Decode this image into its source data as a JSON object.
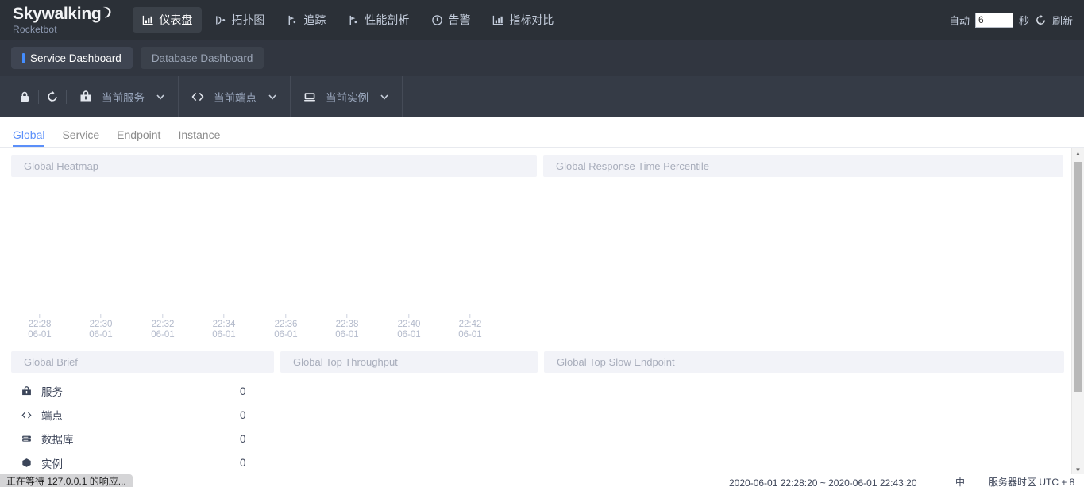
{
  "brand": {
    "name": "Skywalking",
    "sub": "Rocketbot",
    "accent": "#448dfe"
  },
  "topnav": {
    "items": [
      {
        "label": "仪表盘",
        "icon": "dashboard-chart-icon",
        "active": true
      },
      {
        "label": "拓扑图",
        "icon": "topology-icon",
        "active": false
      },
      {
        "label": "追踪",
        "icon": "trace-icon",
        "active": false
      },
      {
        "label": "性能剖析",
        "icon": "profile-icon",
        "active": false
      },
      {
        "label": "告警",
        "icon": "alarm-clock-icon",
        "active": false
      },
      {
        "label": "指标对比",
        "icon": "compare-chart-icon",
        "active": false
      }
    ],
    "auto_label": "自动",
    "interval_value": "6",
    "second_label": "秒",
    "refresh_label": "刷新",
    "refresh_icon": "reload-icon"
  },
  "dashboard_tabs": [
    {
      "label": "Service Dashboard",
      "active": true
    },
    {
      "label": "Database Dashboard",
      "active": false
    }
  ],
  "toolbar": {
    "lock_icon": "lock-icon",
    "reload_icon": "reload-icon",
    "selectors": [
      {
        "label": "当前服务",
        "icon": "service-bag-icon"
      },
      {
        "label": "当前端点",
        "icon": "code-brackets-icon"
      },
      {
        "label": "当前实例",
        "icon": "instance-monitor-icon"
      }
    ]
  },
  "subtabs": [
    {
      "label": "Global",
      "active": true
    },
    {
      "label": "Service",
      "active": false
    },
    {
      "label": "Endpoint",
      "active": false
    },
    {
      "label": "Instance",
      "active": false
    }
  ],
  "panels": {
    "heatmap": {
      "title": "Global Heatmap"
    },
    "percentile": {
      "title": "Global Response Time Percentile"
    },
    "brief": {
      "title": "Global Brief"
    },
    "top_throughput": {
      "title": "Global Top Throughput"
    },
    "top_slow_endpoint": {
      "title": "Global Top Slow Endpoint"
    }
  },
  "brief_rows": [
    {
      "icon": "service-bag-icon",
      "name": "服务",
      "value": "0"
    },
    {
      "icon": "code-brackets-icon",
      "name": "端点",
      "value": "0"
    },
    {
      "icon": "database-icon",
      "name": "数据库",
      "value": "0"
    },
    {
      "icon": "cube-icon",
      "name": "实例",
      "value": "0"
    }
  ],
  "chart_data": {
    "type": "heatmap",
    "title": "Global Heatmap",
    "xlabel": "",
    "ylabel": "",
    "grid": false,
    "legend": "none",
    "x_tick_labels": [
      {
        "time": "22:28",
        "date": "06-01"
      },
      {
        "time": "22:30",
        "date": "06-01"
      },
      {
        "time": "22:32",
        "date": "06-01"
      },
      {
        "time": "22:34",
        "date": "06-01"
      },
      {
        "time": "22:36",
        "date": "06-01"
      },
      {
        "time": "22:38",
        "date": "06-01"
      },
      {
        "time": "22:40",
        "date": "06-01"
      },
      {
        "time": "22:42",
        "date": "06-01"
      }
    ],
    "values": [],
    "note": "no data rendered — empty heatmap"
  },
  "bottombar": {
    "time_range": "2020-06-01 22:28:20 ~ 2020-06-01 22:43:20",
    "lang": "中",
    "timezone": "服务器时区 UTC + 8"
  },
  "browser_status": "正在等待 127.0.0.1 的响应..."
}
